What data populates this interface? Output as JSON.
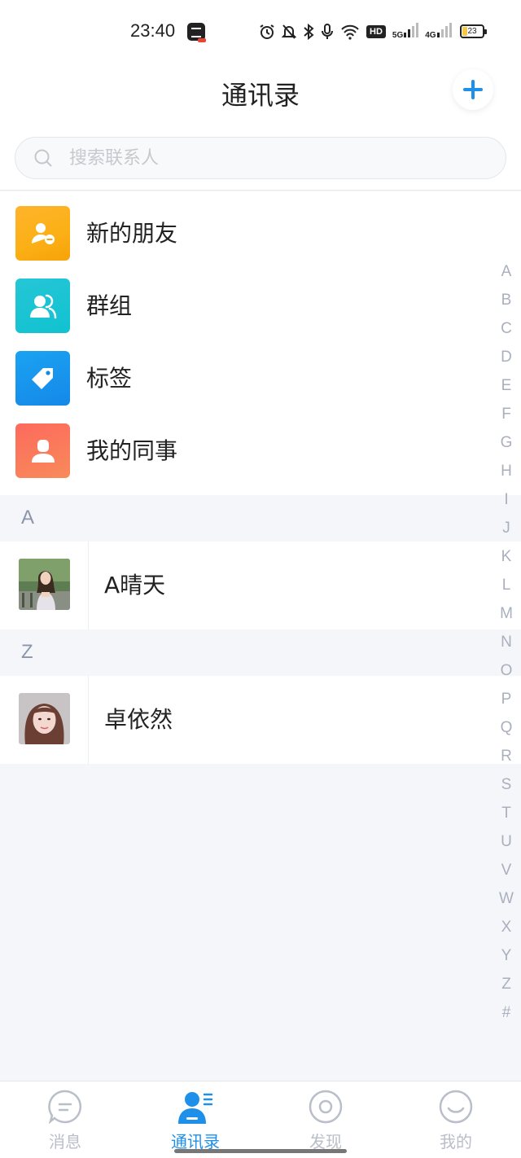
{
  "status_bar": {
    "time": "23:40",
    "battery": "23",
    "network_1": "5G",
    "network_2": "4G",
    "hd_label": "HD",
    "icons": [
      "alarm-icon",
      "mute-icon",
      "bluetooth-icon",
      "mic-icon",
      "wifi-icon",
      "hd-icon",
      "signal-icon",
      "signal-icon",
      "battery-icon"
    ]
  },
  "header": {
    "title": "通讯录",
    "add_icon": "plus-icon"
  },
  "search": {
    "placeholder": "搜索联系人",
    "icon": "search-icon"
  },
  "features": [
    {
      "label": "新的朋友",
      "icon": "new-friend-icon",
      "color": "#fbb015"
    },
    {
      "label": "群组",
      "icon": "group-icon",
      "color": "#11c2d0"
    },
    {
      "label": "标签",
      "icon": "tag-icon",
      "color": "#1588e8"
    },
    {
      "label": "我的同事",
      "icon": "colleague-icon",
      "color": "#fb7a5b"
    }
  ],
  "sections": [
    {
      "letter": "A",
      "contacts": [
        {
          "name": "A晴天",
          "avatar": "photo-avatar-icon"
        }
      ]
    },
    {
      "letter": "Z",
      "contacts": [
        {
          "name": "卓依然",
          "avatar": "photo-avatar-icon"
        }
      ]
    }
  ],
  "index_letters": [
    "A",
    "B",
    "C",
    "D",
    "E",
    "F",
    "G",
    "H",
    "I",
    "J",
    "K",
    "L",
    "M",
    "N",
    "O",
    "P",
    "Q",
    "R",
    "S",
    "T",
    "U",
    "V",
    "W",
    "X",
    "Y",
    "Z",
    "#"
  ],
  "bottom_nav": [
    {
      "label": "消息",
      "icon": "message-icon",
      "active": false
    },
    {
      "label": "通讯录",
      "icon": "contacts-icon",
      "active": true
    },
    {
      "label": "发现",
      "icon": "discover-icon",
      "active": false
    },
    {
      "label": "我的",
      "icon": "profile-icon",
      "active": false
    }
  ],
  "colors": {
    "accent": "#1e90ea",
    "background": "#f4f6fa",
    "section_letter": "#8c96aa",
    "inactive_nav": "#b9bec8"
  }
}
